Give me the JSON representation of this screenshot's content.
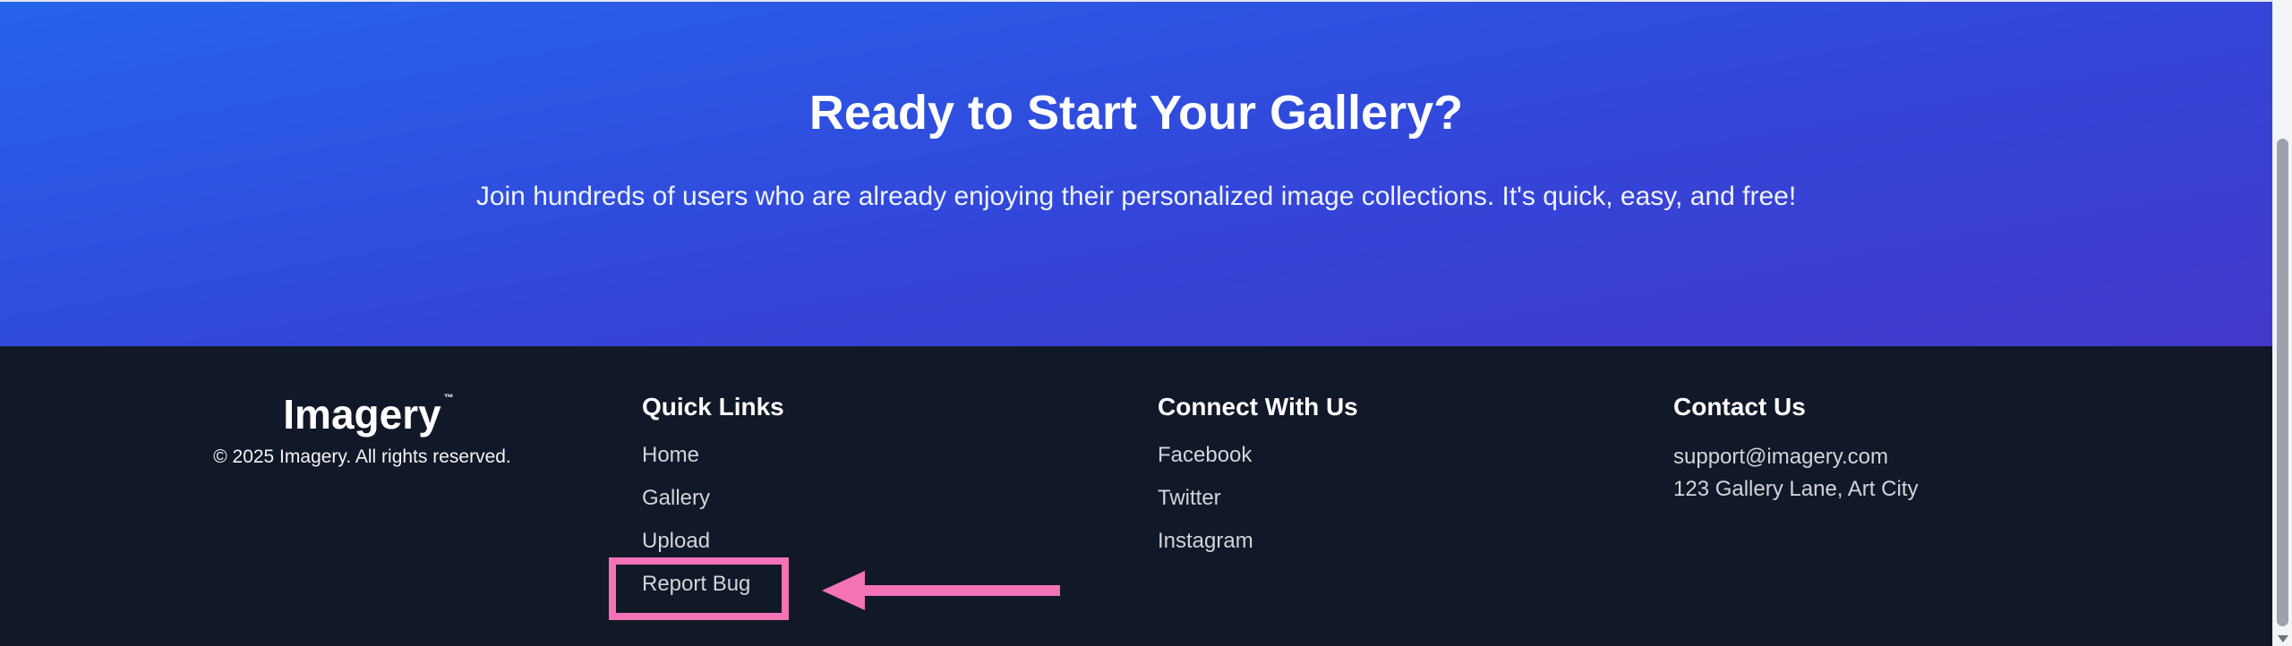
{
  "hero": {
    "title": "Ready to Start Your Gallery?",
    "subtitle": "Join hundreds of users who are already enjoying their personalized image collections. It's quick, easy, and free!"
  },
  "footer": {
    "brand": {
      "name": "Imagery",
      "trademark": "™",
      "copyright": "© 2025 Imagery. All rights reserved."
    },
    "quick_links": {
      "heading": "Quick Links",
      "items": [
        "Home",
        "Gallery",
        "Upload",
        "Report Bug"
      ]
    },
    "connect": {
      "heading": "Connect With Us",
      "items": [
        "Facebook",
        "Twitter",
        "Instagram"
      ]
    },
    "contact": {
      "heading": "Contact Us",
      "email": "support@imagery.com",
      "address": "123 Gallery Lane, Art City"
    }
  },
  "annotation": {
    "highlight_color": "#f472b6",
    "target": "Report Bug"
  },
  "colors": {
    "hero_gradient_start": "#2563eb",
    "hero_gradient_end": "#4338ca",
    "footer_bg": "#111827",
    "link_text": "#d1d5db"
  }
}
